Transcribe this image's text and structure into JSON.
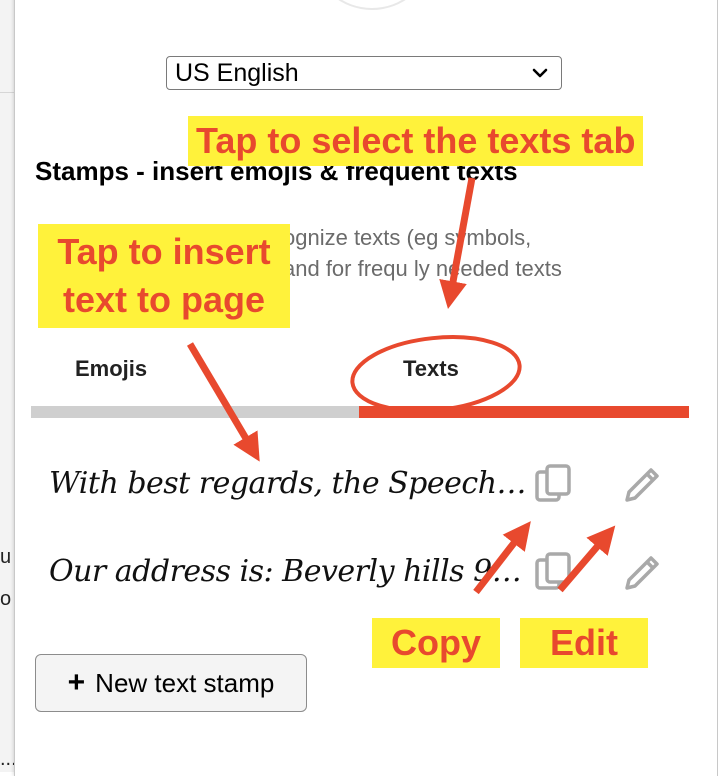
{
  "background": {
    "side_text_1": "u",
    "side_text_2": "o",
    "side_text_3": "..."
  },
  "language_select": {
    "selected": "US English"
  },
  "stamps": {
    "heading": "Stamps - insert emojis & frequent texts",
    "description": "(e.g. to recognize texts (eg symbols, n... and for frequently needed texts",
    "description_line1": "ognize texts (eg symbols,",
    "description_line2": "and for frequ ly needed texts"
  },
  "tabs": [
    {
      "label": "Emojis",
      "active": false
    },
    {
      "label": "Texts",
      "active": true
    }
  ],
  "text_stamps": [
    {
      "text": "With best regards, the Speech…"
    },
    {
      "text": "Our address is: Beverly hills 9…"
    }
  ],
  "icons": {
    "copy": "copy-icon",
    "edit": "pencil-icon",
    "dropdown": "chevron-down-icon"
  },
  "new_button": {
    "plus": "+",
    "label": "New text stamp"
  },
  "annotations": {
    "tabs_callout": "Tap to select the texts tab",
    "insert_callout_line1": "Tap to insert",
    "insert_callout_line2": "text to page",
    "copy_callout": "Copy",
    "edit_callout": "Edit"
  },
  "colors": {
    "accent": "#e8492e",
    "tab_inactive": "#cfcfcf",
    "callout_bg": "#fff23b",
    "icon_gray": "#a9a9a9"
  }
}
